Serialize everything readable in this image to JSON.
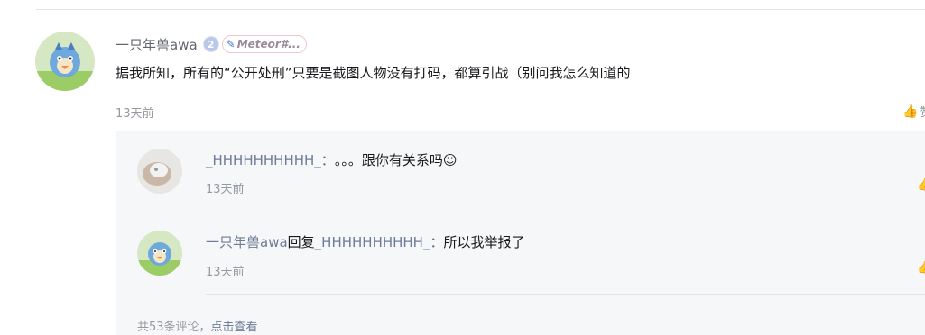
{
  "comment": {
    "username": "一只年兽awa",
    "level": "2",
    "medal": "Meteor#...",
    "content": "据我所知，所有的“公开处刑”只要是截图人物没有打码，都算引战（别问我怎么知道的",
    "time": "13天前",
    "like_label": "赞"
  },
  "replies": [
    {
      "username": "_HHHHHHHHHH_",
      "separator": "：",
      "text": "。。。跟你有关系吗☺",
      "time": "13天前"
    },
    {
      "username": "一只年兽awa",
      "reply_word": "回复",
      "target": "_HHHHHHHHHH_",
      "separator": "：",
      "text": "所以我举报了",
      "time": "13天前"
    }
  ],
  "more": {
    "count_text": "共53条评论，",
    "link_text": "点击查看"
  },
  "icons": {
    "like": "thumbs-up-icon",
    "medal": "pen-icon"
  },
  "colors": {
    "link": "#6d7c99",
    "muted": "#9499a0",
    "reply_bg": "#f6f7f8"
  }
}
